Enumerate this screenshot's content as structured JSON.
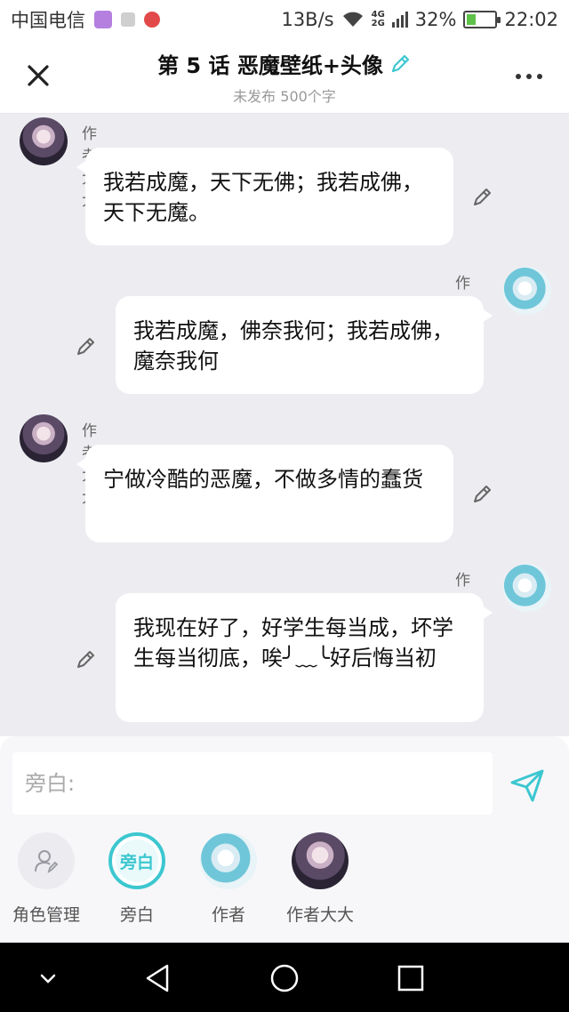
{
  "status_bar": {
    "carrier": "中国电信",
    "speed": "13B/s",
    "net_top": "4G",
    "net_bottom": "2G",
    "battery": "32%",
    "battery_level": 0.32,
    "time": "22:02"
  },
  "header": {
    "title": "第 5 话 恶魔壁纸+头像",
    "subtitle": "未发布 500个字"
  },
  "messages": [
    {
      "side": "left",
      "speaker": "作者大大",
      "avatar": "dark",
      "text": "我若成魔，天下无佛；我若成佛，天下无魔。"
    },
    {
      "side": "right",
      "speaker": "作者",
      "avatar": "light",
      "text": "我若成魔，佛奈我何；我若成佛，魔奈我何"
    },
    {
      "side": "left",
      "speaker": "作者大大",
      "avatar": "dark",
      "text": "宁做冷酷的恶魔，不做多情的蠢货"
    },
    {
      "side": "right",
      "speaker": "作者",
      "avatar": "light",
      "text": "我现在好了，好学生每当成，坏学生每当彻底，唉╯﹏╰好后悔当初"
    }
  ],
  "composer": {
    "placeholder": "旁白:"
  },
  "roles": [
    {
      "label": "角色管理",
      "icon": "role-manage-icon"
    },
    {
      "label": "旁白",
      "badge": "旁白",
      "selected": true
    },
    {
      "label": "作者",
      "avatar": "light"
    },
    {
      "label": "作者大大",
      "avatar": "dark"
    }
  ],
  "colors": {
    "accent": "#3cc7d0",
    "chat_bg": "#ededf1",
    "bubble": "#ffffff"
  }
}
